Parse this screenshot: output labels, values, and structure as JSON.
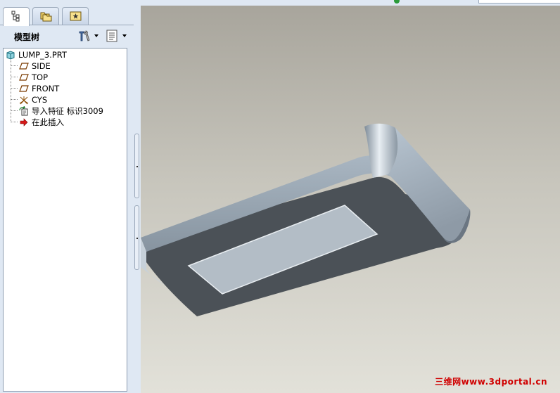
{
  "tabs": [
    {
      "name": "model-tree-tab",
      "icon": "model-tree-icon"
    },
    {
      "name": "folder-browser-tab",
      "icon": "folder-icon"
    },
    {
      "name": "favorites-tab",
      "icon": "favorites-icon"
    }
  ],
  "tree": {
    "title": "模型树",
    "settings_icon": "tools-icon",
    "show_icon": "list-icon",
    "items": [
      {
        "label": "LUMP_3.PRT",
        "icon": "part-icon"
      },
      {
        "label": "SIDE",
        "icon": "datum-plane-icon"
      },
      {
        "label": "TOP",
        "icon": "datum-plane-icon"
      },
      {
        "label": "FRONT",
        "icon": "datum-plane-icon"
      },
      {
        "label": "CYS",
        "icon": "coordinate-system-icon"
      },
      {
        "label": "导入特征 标识3009",
        "icon": "import-feature-icon"
      },
      {
        "label": "在此插入",
        "icon": "insert-here-arrow-icon"
      }
    ]
  },
  "viewport": {
    "watermark": "三维网www.3dportal.cn",
    "background_top": "#a8a59c",
    "background_bottom": "#e2e1d9"
  }
}
